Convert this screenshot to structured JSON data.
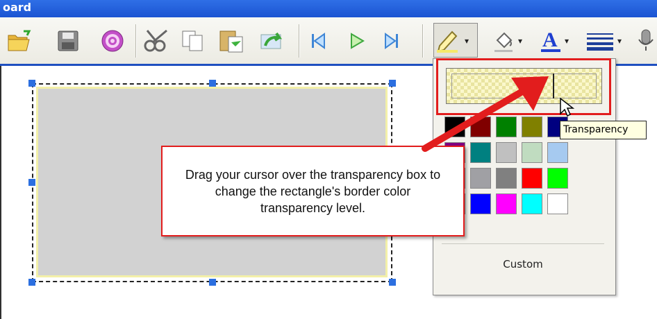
{
  "window": {
    "title": "oard"
  },
  "toolbar": {
    "buttons": [
      {
        "name": "open-folder-icon"
      },
      {
        "name": "save-disk-icon"
      },
      {
        "name": "record-icon"
      },
      {
        "name": "cut-scissors-icon"
      },
      {
        "name": "copy-icon"
      },
      {
        "name": "paste-icon"
      },
      {
        "name": "undo-icon"
      },
      {
        "name": "skip-back-icon"
      },
      {
        "name": "play-icon"
      },
      {
        "name": "skip-forward-icon"
      },
      {
        "name": "line-color-pencil-icon"
      },
      {
        "name": "fill-color-bucket-icon"
      },
      {
        "name": "font-color-icon"
      },
      {
        "name": "line-style-icon"
      },
      {
        "name": "microphone-icon"
      }
    ],
    "dropdown_arrow": "▾"
  },
  "color_panel": {
    "transparency_tooltip": "Transparency",
    "custom_label": "Custom",
    "swatches": [
      [
        "#000000",
        "#800000",
        "#008000",
        "#808000",
        "#000080"
      ],
      [
        "#800080",
        "#008080",
        "#c0c0c0",
        "#c0dcc0",
        "#a6caf0"
      ],
      [
        "#808080",
        "#a0a0a4",
        "#808080",
        "#ff0000",
        "#00ff00"
      ],
      [
        "#ffff00",
        "#0000ff",
        "#ff00ff",
        "#00ffff",
        "#ffffff"
      ]
    ],
    "transparency_level": 0.7
  },
  "callout": {
    "text": "Drag your cursor over the transparency box to change the rectangle's border color transparency level."
  },
  "colors": {
    "accent_red": "#e21d1d",
    "selection_handle": "#2c6fe0",
    "rect_fill": "#d2d2d2",
    "rect_border": "#f3f0a8",
    "titlebar": "#1b54d2"
  }
}
